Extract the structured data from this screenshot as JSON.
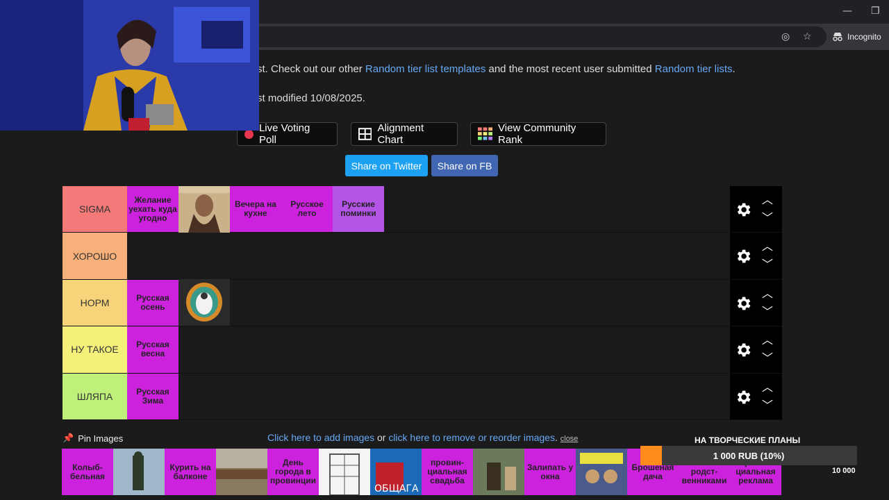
{
  "browser": {
    "incognito_label": "Incognito",
    "minimize_glyph": "—",
    "maximize_glyph": "❐",
    "eye_icon_glyph": "◎",
    "star_icon_glyph": "☆"
  },
  "page": {
    "intro_prefix": "st. Check out our other ",
    "intro_link1": "Random tier list templates",
    "intro_mid": " and the most recent user submitted ",
    "intro_link2": "Random tier lists",
    "intro_suffix": ".",
    "modified": "st modified 10/08/2025."
  },
  "toolbar": {
    "live_voting": "Live Voting Poll",
    "alignment_chart": "Alignment Chart",
    "community_rank": "View Community Rank",
    "share_twitter": "Share on Twitter",
    "share_fb": "Share on FB"
  },
  "tiers": [
    {
      "label": "SIGMA",
      "color": "#f47a7a",
      "items": [
        "Желание уехать куда угодно",
        "[portrait]",
        "Вечера на кухне",
        "Русское лето",
        "Русские поминки"
      ]
    },
    {
      "label": "ХОРОШО",
      "color": "#f7b07a",
      "items": []
    },
    {
      "label": "НОРМ",
      "color": "#f7d47a",
      "items": [
        "Русская осень",
        "[artwork]"
      ]
    },
    {
      "label": "НУ ТАКОЕ",
      "color": "#f5f07a",
      "items": [
        "Русская весна"
      ]
    },
    {
      "label": "ШЛЯПА",
      "color": "#bff07a",
      "items": [
        "Русская Зима"
      ]
    }
  ],
  "pin": {
    "label": "Pin Images",
    "add_link": "Click here to add images",
    "or": " or ",
    "remove_link": "click here to remove or reorder images",
    "dot": ". ",
    "close": "close"
  },
  "pool": [
    "Колыб-бельная",
    "[statue]",
    "Курить на балконе",
    "[rail]",
    "День города в провинции",
    "[building]",
    "[Общага]",
    "провин-циальная свадьба",
    "[room]",
    "Залипать у окна",
    "[poster]",
    "Брошеная дача",
    "Застолье с родст-венниками",
    "Провин-циальная реклама"
  ],
  "overlay": {
    "title": "НА ТВОРЧЕСКИЕ ПЛАНЫ",
    "progress_text": "1 000 RUB (10%)",
    "progress_fraction": 0.1,
    "max_label": "10 000"
  }
}
